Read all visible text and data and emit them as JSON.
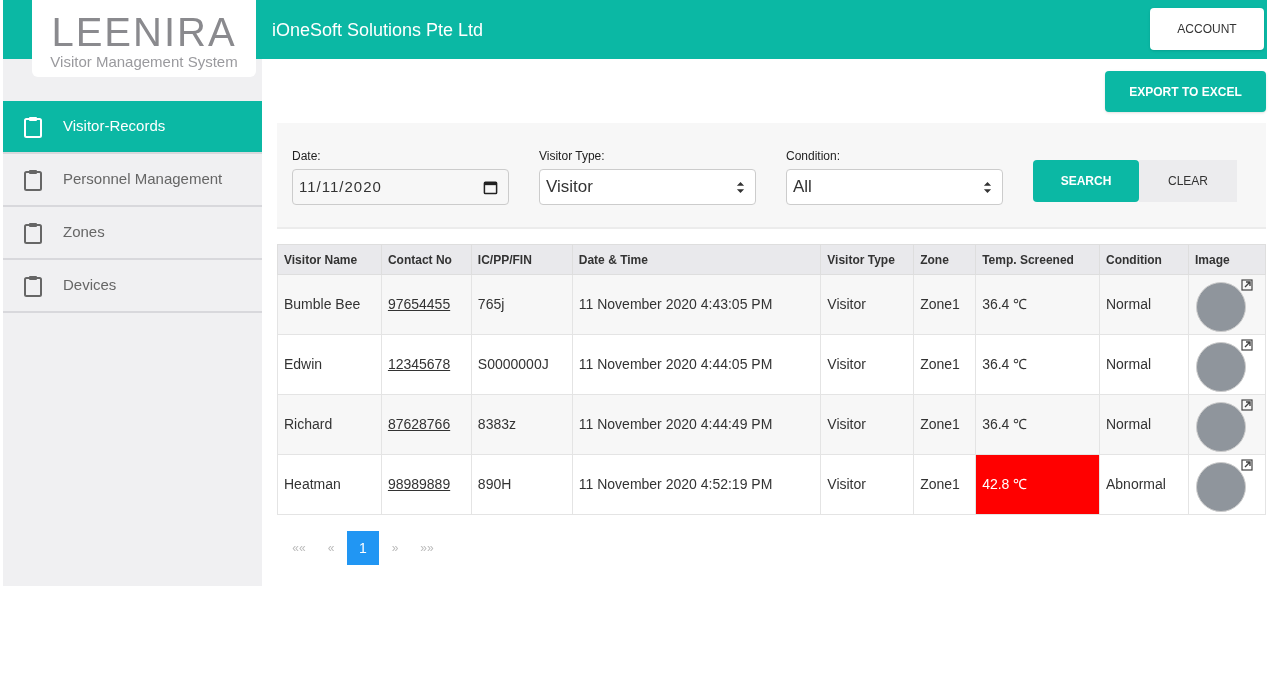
{
  "logo": {
    "wordmark": "LEENIRA",
    "tagline": "Visitor Management System"
  },
  "header": {
    "company": "iOneSoft Solutions Pte Ltd",
    "account_button": "ACCOUNT"
  },
  "sidebar": {
    "items": [
      {
        "label": "Visitor-Records",
        "selected": true
      },
      {
        "label": "Personnel Management",
        "selected": false
      },
      {
        "label": "Zones",
        "selected": false
      },
      {
        "label": "Devices",
        "selected": false
      }
    ]
  },
  "export_button": "EXPORT TO EXCEL",
  "filters": {
    "date": {
      "label": "Date:",
      "value": "11/11/2020"
    },
    "visitor_type": {
      "label": "Visitor Type:",
      "value": "Visitor"
    },
    "condition": {
      "label": "Condition:",
      "value": "All"
    },
    "search_button": "SEARCH",
    "clear_button": "CLEAR"
  },
  "table": {
    "columns": [
      "Visitor Name",
      "Contact No",
      "IC/PP/FIN",
      "Date & Time",
      "Visitor Type",
      "Zone",
      "Temp. Screened",
      "Condition",
      "Image"
    ],
    "rows": [
      {
        "name": "Bumble Bee",
        "contact": "97654455",
        "id": "765j",
        "datetime": "11 November 2020 4:43:05 PM",
        "type": "Visitor",
        "zone": "Zone1",
        "temp": "36.4 ℃",
        "abnormal": false,
        "condition": "Normal"
      },
      {
        "name": "Edwin",
        "contact": "12345678",
        "id": "S0000000J",
        "datetime": "11 November 2020 4:44:05 PM",
        "type": "Visitor",
        "zone": "Zone1",
        "temp": "36.4 ℃",
        "abnormal": false,
        "condition": "Normal"
      },
      {
        "name": "Richard",
        "contact": "87628766",
        "id": "8383z",
        "datetime": "11 November 2020 4:44:49 PM",
        "type": "Visitor",
        "zone": "Zone1",
        "temp": "36.4 ℃",
        "abnormal": false,
        "condition": "Normal"
      },
      {
        "name": "Heatman",
        "contact": "98989889",
        "id": "890H",
        "datetime": "11 November 2020 4:52:19 PM",
        "type": "Visitor",
        "zone": "Zone1",
        "temp": "42.8 ℃",
        "abnormal": true,
        "condition": "Abnormal"
      }
    ]
  },
  "pagination": [
    {
      "label": "««",
      "selected": false,
      "disabled": true
    },
    {
      "label": "«",
      "selected": false,
      "disabled": true
    },
    {
      "label": "1",
      "selected": true,
      "disabled": false
    },
    {
      "label": "»",
      "selected": false,
      "disabled": true
    },
    {
      "label": "»»",
      "selected": false,
      "disabled": true
    }
  ]
}
